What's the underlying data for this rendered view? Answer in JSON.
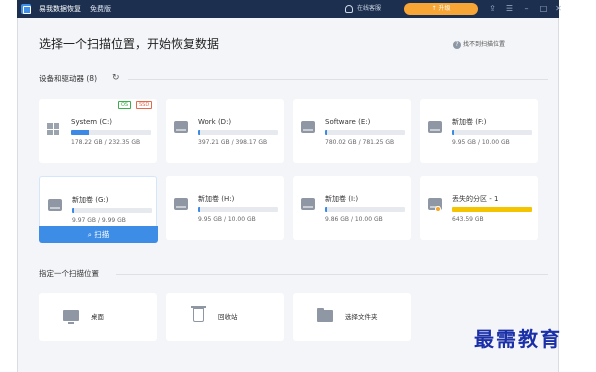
{
  "titlebar": {
    "app_name": "易我数据恢复",
    "edition": "免费版",
    "support_label": "在线客服",
    "upgrade_label": "↑ 升级"
  },
  "header": {
    "title": "选择一个扫描位置，开始恢复数据",
    "help_link": "找不到扫描位置"
  },
  "devices": {
    "section_title": "设备和驱动器 (8)",
    "drives": [
      {
        "name": "System (C:)",
        "size": "178.22 GB / 232.35 GB",
        "used_fraction": 0.23,
        "badges": [
          "OS",
          "SSD"
        ],
        "icon": "windows-icon"
      },
      {
        "name": "Work (D:)",
        "size": "397.21 GB / 398.17 GB",
        "used_fraction": 0.03,
        "icon": "drive-icon"
      },
      {
        "name": "Software (E:)",
        "size": "780.02 GB / 781.25 GB",
        "used_fraction": 0.03,
        "icon": "drive-icon"
      },
      {
        "name": "新加卷 (F:)",
        "size": "9.95 GB / 10.00 GB",
        "used_fraction": 0.03,
        "icon": "drive-icon"
      },
      {
        "name": "新加卷 (G:)",
        "size": "9.97 GB / 9.99 GB",
        "used_fraction": 0.03,
        "icon": "drive-icon",
        "selected": true,
        "scan_label": "扫描"
      },
      {
        "name": "新加卷 (H:)",
        "size": "9.95 GB / 10.00 GB",
        "used_fraction": 0.03,
        "icon": "drive-icon"
      },
      {
        "name": "新加卷 (I:)",
        "size": "9.86 GB / 10.00 GB",
        "used_fraction": 0.03,
        "icon": "drive-icon"
      },
      {
        "name": "丢失的分区 - 1",
        "size": "643.59 GB",
        "used_fraction": 1.0,
        "icon": "lost-partition-icon"
      }
    ]
  },
  "locations": {
    "section_title": "指定一个扫描位置",
    "items": [
      {
        "label": "桌面",
        "icon": "desktop-icon"
      },
      {
        "label": "回收站",
        "icon": "recycle-bin-icon"
      },
      {
        "label": "选择文件夹",
        "icon": "folder-icon"
      }
    ]
  },
  "watermark": "最需教育"
}
